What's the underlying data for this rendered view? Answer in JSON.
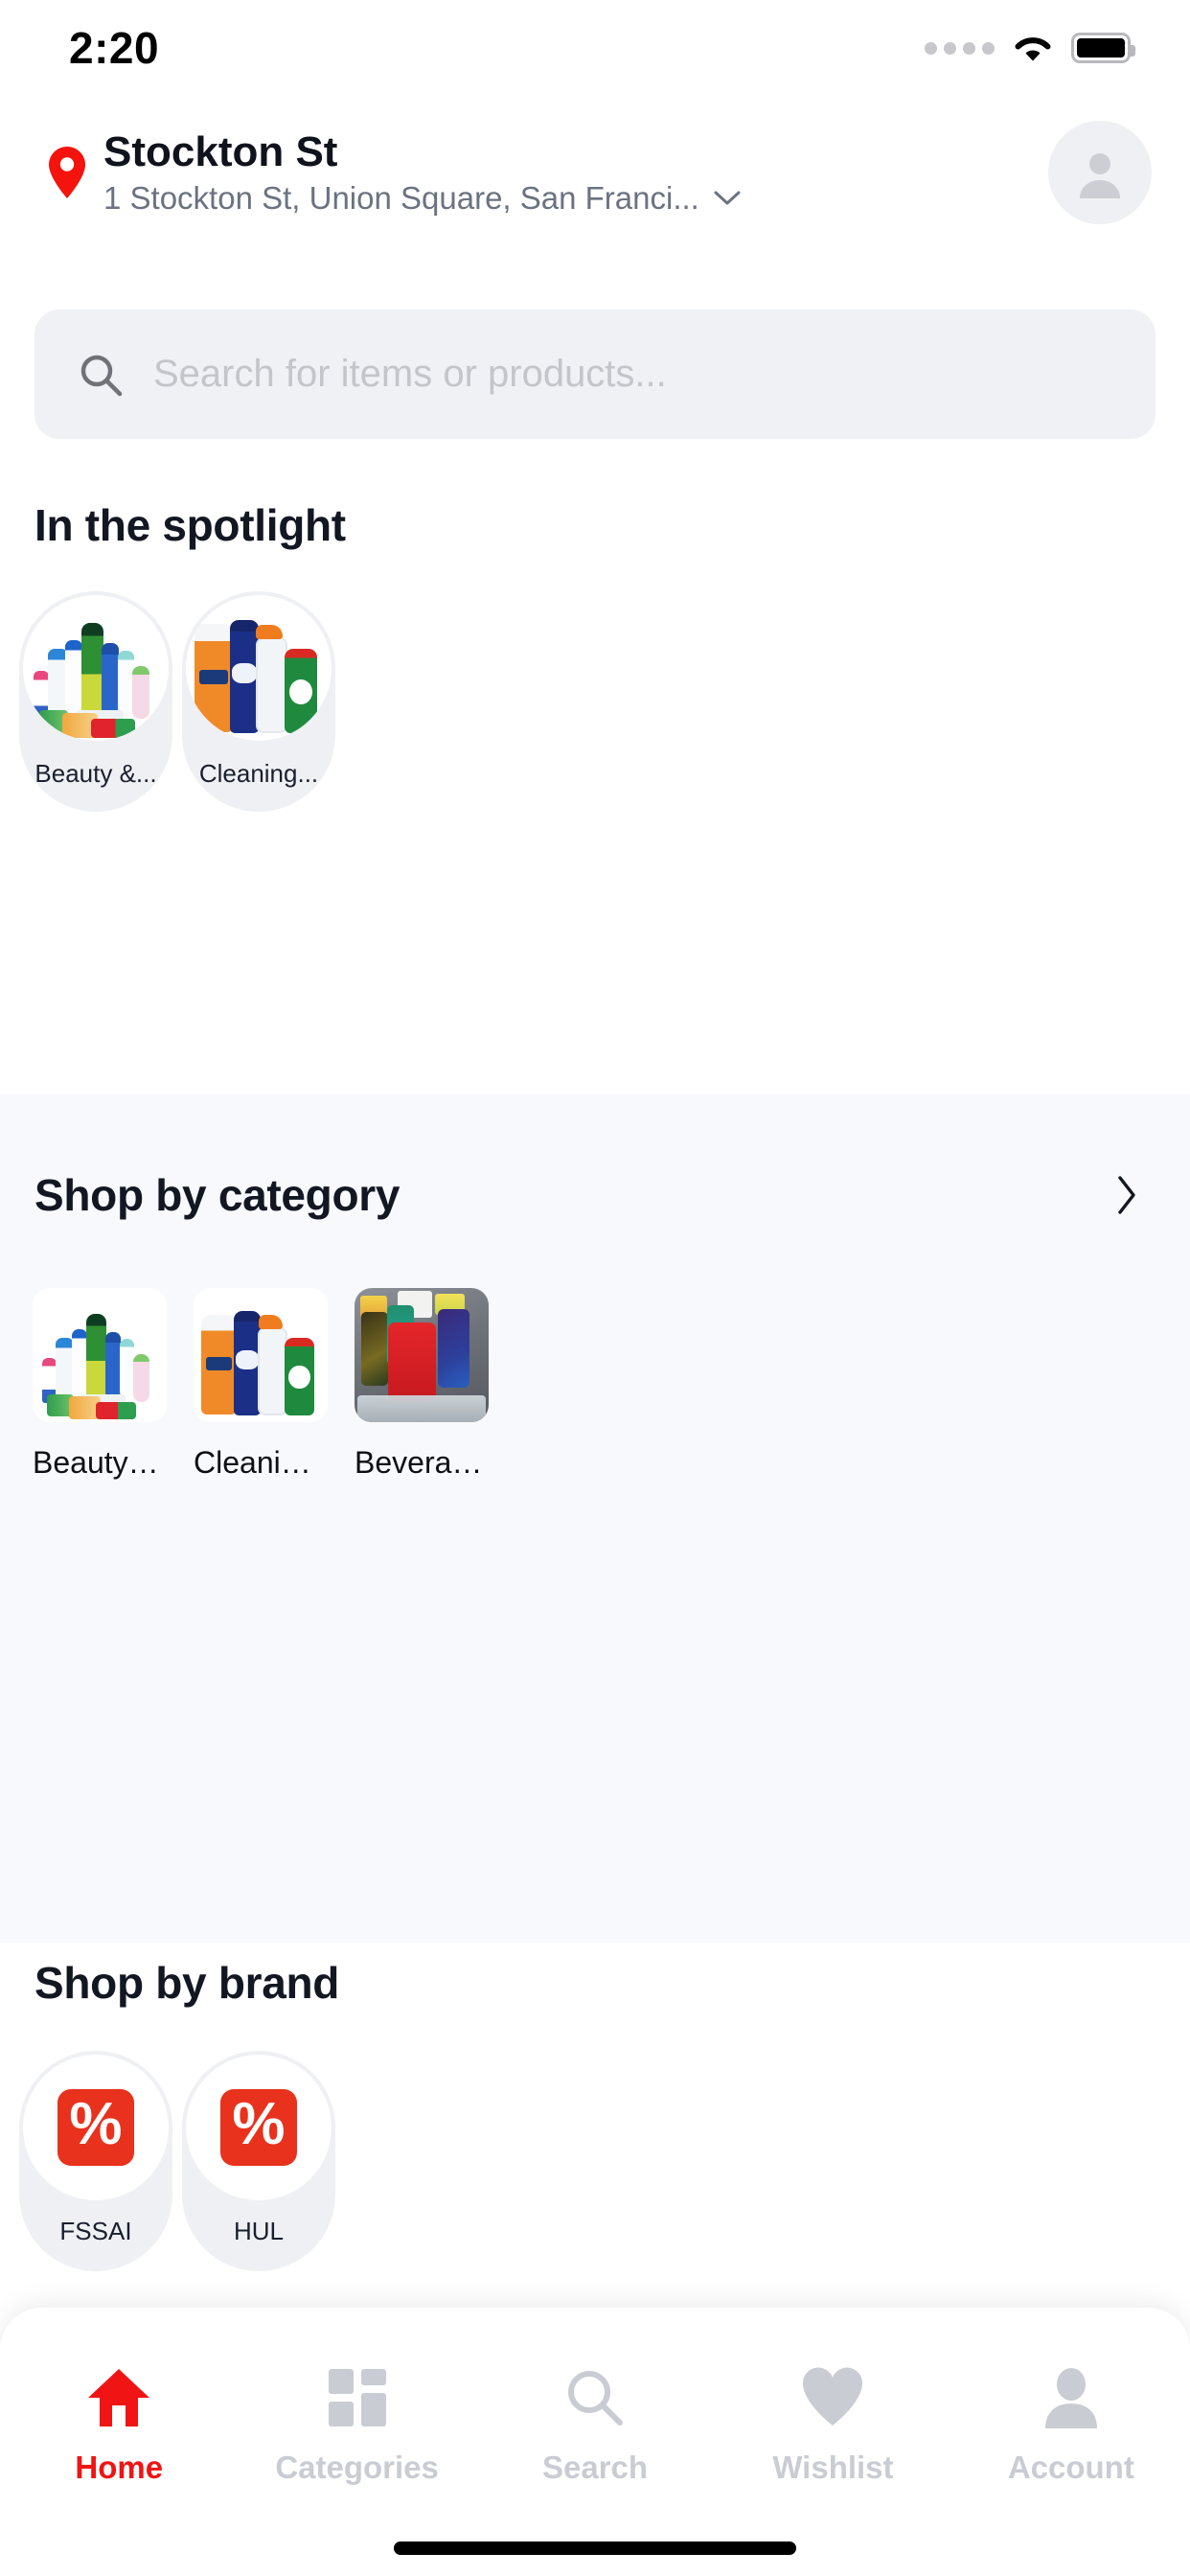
{
  "status_bar": {
    "time": "2:20",
    "signal_icon": "signal-dots-icon",
    "wifi_icon": "wifi-icon",
    "battery_icon": "battery-full-icon"
  },
  "header": {
    "pin_icon": "location-pin-icon",
    "title": "Stockton St",
    "address": "1 Stockton St, Union Square, San Franci...",
    "chevron_icon": "chevron-down-icon",
    "avatar_icon": "user-avatar-icon"
  },
  "search": {
    "icon": "search-icon",
    "placeholder": "Search for items or products..."
  },
  "spotlight": {
    "title": "In the spotlight",
    "items": [
      {
        "label": "Beauty &...",
        "image": "beauty-products-collage"
      },
      {
        "label": "Cleaning...",
        "image": "cleaning-products-collage"
      }
    ]
  },
  "shop_by_category": {
    "title": "Shop by category",
    "arrow_icon": "chevron-right-icon",
    "items": [
      {
        "label": "Beauty & Hy...",
        "image": "beauty-products-collage"
      },
      {
        "label": "Cleaning &...",
        "image": "cleaning-products-collage"
      },
      {
        "label": "Beverages",
        "image": "beverages-cans-photo"
      }
    ]
  },
  "shop_by_brand": {
    "title": "Shop by brand",
    "items": [
      {
        "label": "FSSAI",
        "icon": "percent-badge-icon",
        "symbol": "%"
      },
      {
        "label": "HUL",
        "icon": "percent-badge-icon",
        "symbol": "%"
      }
    ]
  },
  "bottom_nav": {
    "items": [
      {
        "label": "Home",
        "icon": "home-icon",
        "active": true
      },
      {
        "label": "Categories",
        "icon": "grid-icon",
        "active": false
      },
      {
        "label": "Search",
        "icon": "search-icon",
        "active": false
      },
      {
        "label": "Wishlist",
        "icon": "heart-icon",
        "active": false
      },
      {
        "label": "Account",
        "icon": "person-icon",
        "active": false
      }
    ]
  },
  "colors": {
    "accent_red": "#f01414",
    "brand_badge_red": "#e8321d",
    "pin_red": "#f5130d",
    "text_dark": "#131722",
    "text_muted": "#6b7280",
    "nav_inactive": "#c9ccd2",
    "surface_gray": "#eff0f3",
    "band_bg": "#f8f9fc"
  }
}
